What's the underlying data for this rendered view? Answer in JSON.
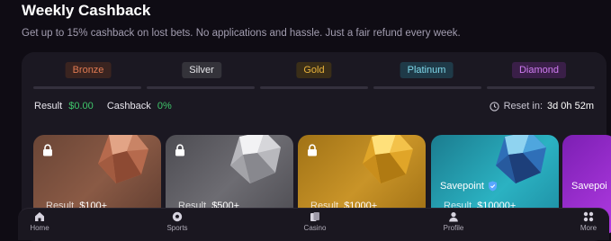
{
  "header": {
    "title": "Weekly Cashback",
    "subtitle": "Get up to 15% cashback on lost bets. No applications and hassle. Just a fair refund every week."
  },
  "tiers": [
    {
      "label": "Bronze",
      "color": "#e07a52",
      "bg": "#3a2420"
    },
    {
      "label": "Silver",
      "color": "#e6e6ea",
      "bg": "#34333a"
    },
    {
      "label": "Gold",
      "color": "#e8b23b",
      "bg": "#3a2e18"
    },
    {
      "label": "Platinum",
      "color": "#7fd8ea",
      "bg": "#1f3a48"
    },
    {
      "label": "Diamond",
      "color": "#d07cf2",
      "bg": "#3a1f48"
    }
  ],
  "stats": {
    "result_label": "Result",
    "result_value": "$0.00",
    "cashback_label": "Cashback",
    "cashback_value": "0%",
    "reset_label": "Reset in:",
    "reset_value": "3d 0h 52m"
  },
  "cards": {
    "bronze": {
      "result_label": "Result",
      "result_value": "$100+"
    },
    "silver": {
      "result_label": "Result",
      "result_value": "$500+"
    },
    "gold": {
      "result_label": "Result",
      "result_value": "$1000+"
    },
    "platinum": {
      "savepoint": "Savepoint",
      "result_label": "Result",
      "result_value": "$10000+"
    },
    "diamond": {
      "savepoint": "Savepoi"
    }
  },
  "nav": [
    {
      "label": "Home",
      "icon": "home-icon"
    },
    {
      "label": "Sports",
      "icon": "soccer-ball-icon"
    },
    {
      "label": "Casino",
      "icon": "cards-icon"
    },
    {
      "label": "Profile",
      "icon": "user-icon"
    },
    {
      "label": "More",
      "icon": "grid-icon"
    }
  ]
}
